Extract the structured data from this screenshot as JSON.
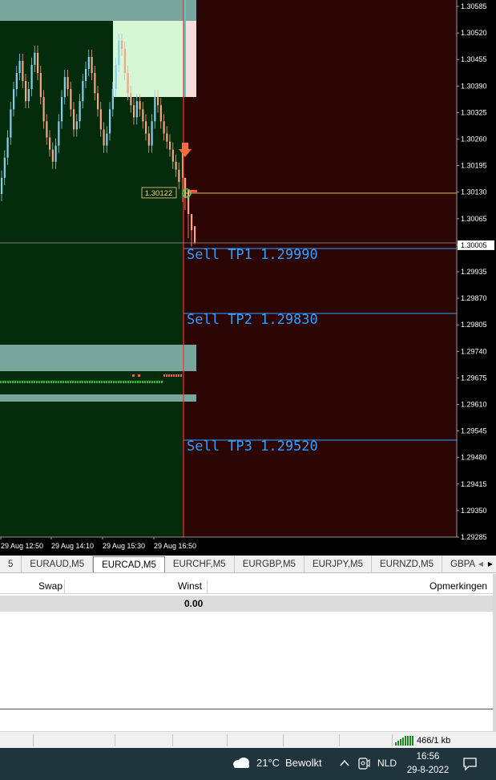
{
  "chart": {
    "symbol": "EURCAD,M5",
    "colors": {
      "background_left": "#042b0b",
      "background_right": "#2c0505",
      "bull_candle": "#87ceeb",
      "bear_candle": "#f4a582",
      "grid_line": "#c0c0c0",
      "bid_line": "#ffd27f",
      "tp_line": "#2f9fff",
      "zone_teal": "#79a69c",
      "zone_light_green": "#d6f7d6",
      "zone_pink": "#f6dede",
      "sell_arrow": "#ff6a3d",
      "green_dots": "#1ec81e",
      "red_dots": "#ff5a3c"
    },
    "price_axis_labels": [
      "1.30585",
      "1.30520",
      "1.30455",
      "1.30390",
      "1.30325",
      "1.30260",
      "1.30195",
      "1.30130",
      "1.30065",
      "1.30005",
      "1.29935",
      "1.29870",
      "1.29805",
      "1.29740",
      "1.29675",
      "1.29610",
      "1.29545",
      "1.29480",
      "1.29415",
      "1.29350",
      "1.29285"
    ],
    "current_price": "1.30005",
    "entry_price_label": "1.30122",
    "time_axis_labels": [
      "29 Aug 12:50",
      "29 Aug 14:10",
      "29 Aug 15:30",
      "29 Aug 16:50"
    ],
    "tp_labels": [
      "Sell  TP1  1.29990",
      "Sell  TP2  1.29830",
      "Sell  TP3  1.29520"
    ]
  },
  "tabs": {
    "items": [
      "5",
      "EURAUD,M5",
      "EURCAD,M5",
      "EURCHF,M5",
      "EURGBP,M5",
      "EURJPY,M5",
      "EURNZD,M5",
      "GBPAU"
    ],
    "active": "EURCAD,M5"
  },
  "terminal": {
    "columns": {
      "swap": "Swap",
      "profit": "Winst",
      "comment": "Opmerkingen"
    },
    "total_profit": "0.00"
  },
  "statusbar": {
    "traffic": "466/1 kb"
  },
  "taskbar": {
    "temperature": "21°C",
    "weather": "Bewolkt",
    "language": "NLD",
    "time": "16:56",
    "date": "29-8-2022"
  }
}
